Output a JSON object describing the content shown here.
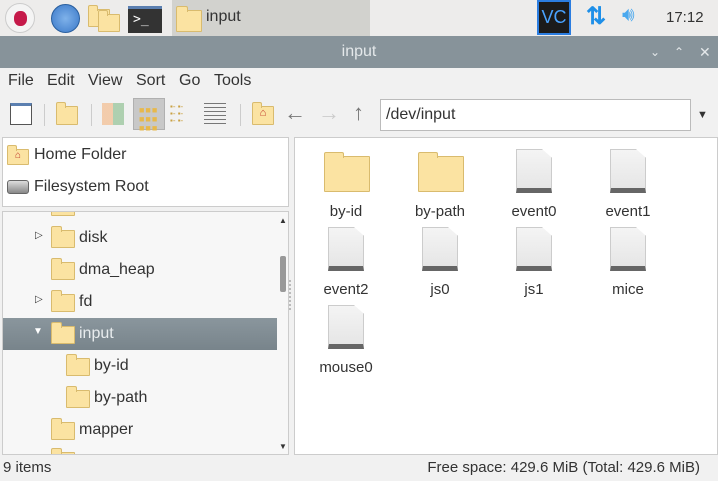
{
  "taskbar": {
    "active_task": "input",
    "clock": "17:12"
  },
  "window": {
    "title": "input"
  },
  "menu": [
    "File",
    "Edit",
    "View",
    "Sort",
    "Go",
    "Tools"
  ],
  "location": {
    "path": "/dev/input"
  },
  "places": [
    {
      "label": "Home Folder"
    },
    {
      "label": "Filesystem Root"
    }
  ],
  "tree": [
    {
      "label": "disk"
    },
    {
      "label": "dma_heap"
    },
    {
      "label": "fd"
    },
    {
      "label": "input"
    },
    {
      "label": "by-id"
    },
    {
      "label": "by-path"
    },
    {
      "label": "mapper"
    }
  ],
  "files": [
    {
      "name": "by-id",
      "type": "folder"
    },
    {
      "name": "by-path",
      "type": "folder"
    },
    {
      "name": "event0",
      "type": "file"
    },
    {
      "name": "event1",
      "type": "file"
    },
    {
      "name": "event2",
      "type": "file"
    },
    {
      "name": "js0",
      "type": "file"
    },
    {
      "name": "js1",
      "type": "file"
    },
    {
      "name": "mice",
      "type": "file"
    },
    {
      "name": "mouse0",
      "type": "file"
    }
  ],
  "status": {
    "items": "9 items",
    "free_space": "Free space: 429.6 MiB (Total: 429.6 MiB)"
  }
}
